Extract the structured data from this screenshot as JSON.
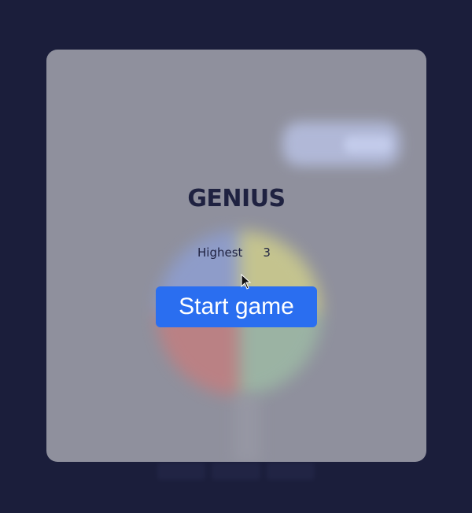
{
  "game": {
    "title": "GENIUS",
    "highest_label": "Highest",
    "highest_value": "3",
    "start_button_label": "Start game"
  },
  "colors": {
    "background": "#1b1e3b",
    "overlay_panel": "#8f909d",
    "start_button": "#2a6ef0",
    "text": "#1f2241",
    "board_blue": "#8ea0d8",
    "board_yellow": "#d6d58a",
    "board_red": "#c97c7c",
    "board_green": "#9fbfa6"
  },
  "icons": {
    "cursor": "mouse-pointer-icon"
  }
}
